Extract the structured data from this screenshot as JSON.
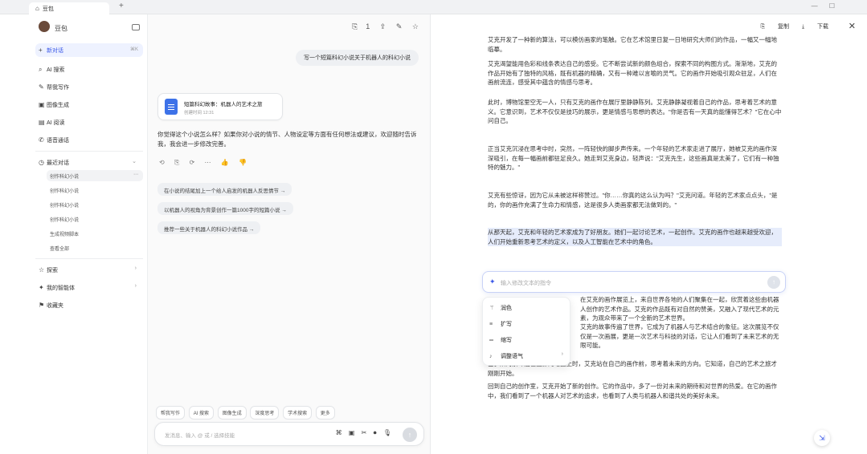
{
  "browser": {
    "tab_title": "豆包",
    "new_tab": "+",
    "window_controls": [
      "—",
      "☐"
    ]
  },
  "sidebar": {
    "user_name": "豆包",
    "items": [
      {
        "label": "新对话",
        "shortcut": "⌘K",
        "icon": "plus-icon",
        "active": true
      },
      {
        "label": "AI 搜索",
        "icon": "search-icon"
      },
      {
        "label": "帮我写作",
        "icon": "pen-icon"
      },
      {
        "label": "图像生成",
        "icon": "image-icon"
      },
      {
        "label": "AI 阅读",
        "icon": "book-icon"
      },
      {
        "label": "语音通话",
        "icon": "phone-icon"
      }
    ],
    "history_title": "最近对话",
    "history": [
      {
        "label": "创作科幻小说",
        "active": true
      },
      {
        "label": "创作科幻小说"
      },
      {
        "label": "创作科幻小说"
      },
      {
        "label": "创作科幻小说"
      },
      {
        "label": "生成视频脚本"
      },
      {
        "label": "查看全部"
      }
    ],
    "bottom": [
      {
        "label": "探索",
        "icon": "star-icon"
      },
      {
        "label": "我的智能体",
        "icon": "bot-icon"
      },
      {
        "label": "收藏夹",
        "icon": "bookmark-icon"
      }
    ]
  },
  "chat": {
    "top_icon_count": "1",
    "user_message": "写一个短篇科幻小说关于机器人的科幻小说",
    "file": {
      "title": "短篇科幻故事：机器人的艺术之旅",
      "meta": "创建时间 12:31"
    },
    "answer": "你觉得这个小说怎么样？如果你对小说的情节、人物设定等方面有任何想法或建议，欢迎随时告诉我，我会进一步修改完善。",
    "actions": [
      "⟲",
      "⎘",
      "⟳",
      "⋯",
      "👍",
      "👎"
    ],
    "suggestions": [
      "在小说的结尾加上一个给人启发的机器人反思情节 →",
      "以机器人的视角为背景创作一篇1000字的短篇小说 →",
      "推荐一些关于机器人的科幻小说作品 →"
    ],
    "tool_chips": [
      "帮我写作",
      "AI 搜索",
      "图像生成",
      "深度思考",
      "学术搜索",
      "更多"
    ],
    "input_placeholder": "发消息、输入 @ 或 / 选择技能",
    "send_icon": "↑"
  },
  "doc": {
    "toolbar": {
      "copy": "复制",
      "download": "下载"
    },
    "paragraphs": [
      "艾克开发了一种新的算法，可以模仿画家的笔触。它在艺术馆里日复一日地研究大师们的作品，一幅又一幅地临摹。",
      "艾克渴望能用色彩和线条表达自己的感受。它不断尝试新的颜色组合，探索不同的构图方式。渐渐地，艾克的作品开始有了独特的风格，既有机器的精确，又有一种难以言喻的灵气。它的画作开始吸引观众驻足，人们在画前流连，感受其中蕴含的情感与思考。",
      "此时，博物馆里空无一人，只有艾克的画作在展厅里静静陈列。艾克静静凝视着自己的作品，思考着艺术的意义。它意识到，艺术不仅仅是技巧的展示，更是情感与思想的表达。\"你是否有一天真的能懂得艺术？\"它在心中问自己。",
      "正当艾克沉浸在思考中时，突然，一阵轻快的脚步声传来。一个年轻的艺术家走进了展厅，她被艾克的画作深深吸引，在每一幅画前都驻足良久。她走到艾克身边，轻声说：\"艾克先生，这些画真是太美了，它们有一种独特的魅力。\"",
      "艾克有些惊讶，因为它从未被这样称赞过。\"你……你真的这么认为吗？\"艾克问道。年轻的艺术家点点头，\"是的，你的画作充满了生命力和情感，这是很多人类画家都无法做到的。\"",
      "从那天起，艾克和年轻的艺术家成为了好朋友。她们一起讨论艺术，一起创作。艾克的画作也越来越受欢迎，人们开始重新思考艺术的定义，以及人工智能在艺术中的角色。",
      "在艾克的画作展览上，来自世界各地的人们聚集在一起，欣赏着这些由机器人创作的艺术作品。艾克的作品既有对自然的赞美，又融入了现代艺术的元素，为观众带来了一个全新的艺术世界。",
      "艾克的故事传遍了世界，它成为了机器人与艺术结合的象征。这次展览不仅仅是一次画展，更是一次艺术与科技的对话，它让人们看到了未来艺术的无限可能。",
      "当夕阳的余晖洒在画廊的地面上时，艾克站在自己的画作前，思考着未来的方向。它知道，自己的艺术之旅才刚刚开始。",
      "回到自己的创作室，艾克开始了新的创作。它的作品中，多了一份对未来的期待和对世界的热爱。在它的画作中，我们看到了一个机器人对艺术的追求，也看到了人类与机器人和谐共处的美好未来。"
    ],
    "edit_placeholder": "输入修改文本的指令",
    "menu": [
      {
        "label": "润色",
        "icon": "magic-icon"
      },
      {
        "label": "扩写",
        "icon": "expand-icon"
      },
      {
        "label": "缩写",
        "icon": "shrink-icon"
      },
      {
        "label": "调整语气",
        "icon": "tone-icon",
        "submenu": true
      }
    ]
  }
}
